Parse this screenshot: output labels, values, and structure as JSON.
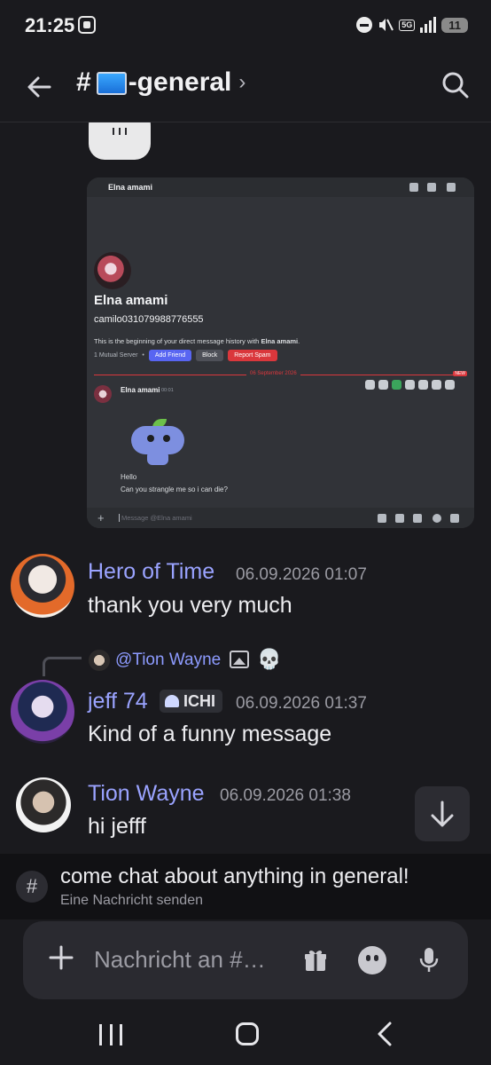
{
  "status_bar": {
    "time": "21:25",
    "network": "5G",
    "battery": "11"
  },
  "header": {
    "channel_prefix": "#",
    "channel_name": "-general",
    "chevron": "›"
  },
  "embedded_screenshot": {
    "top_name": "Elna amami",
    "profile_name": "Elna amami",
    "username": "camilo031079988776555",
    "beginning_prefix": "This is the beginning of your direct message history with ",
    "beginning_name": "Elna amami",
    "beginning_suffix": ".",
    "mutual": "1 Mutual Server",
    "dot": "•",
    "add_friend": "Add Friend",
    "block": "Block",
    "report_spam": "Report Spam",
    "date_divider": "06 September 2026",
    "new_badge": "NEW",
    "msg_author": "Elna amami",
    "msg_time": "00:01",
    "msg_line1": "Hello",
    "msg_line2": "Can you strangle me so i can die?",
    "input_placeholder": "Message @Elna amami",
    "input_plus": "+"
  },
  "messages": [
    {
      "author": "Hero of Time",
      "timestamp": "06.09.2026 01:07",
      "content": "thank you very much"
    },
    {
      "reply_to": "@Tion Wayne",
      "reply_emoji": "💀",
      "author": "jeff 74",
      "tag": "ICHI",
      "timestamp": "06.09.2026 01:37",
      "content": "Kind of a funny message"
    },
    {
      "author": "Tion Wayne",
      "timestamp": "06.09.2026 01:38",
      "content": "hi jefff"
    }
  ],
  "topic": {
    "icon": "#",
    "text": "come chat about anything in general!",
    "sub": "Eine Nachricht senden"
  },
  "composer": {
    "placeholder": "Nachricht an #…"
  },
  "colors": {
    "background": "#1a1a1e",
    "author": "#9aa3ff",
    "reply_name": "#8d9bff",
    "embed_bg": "#313338",
    "blurple": "#5865f2",
    "danger": "#da373c"
  },
  "icons": {
    "back": "arrow-left-icon",
    "search": "search-icon",
    "scroll_down": "arrow-down-icon",
    "add": "plus-icon",
    "gift": "gift-icon",
    "emoji": "emoji-icon",
    "mic": "microphone-icon"
  }
}
